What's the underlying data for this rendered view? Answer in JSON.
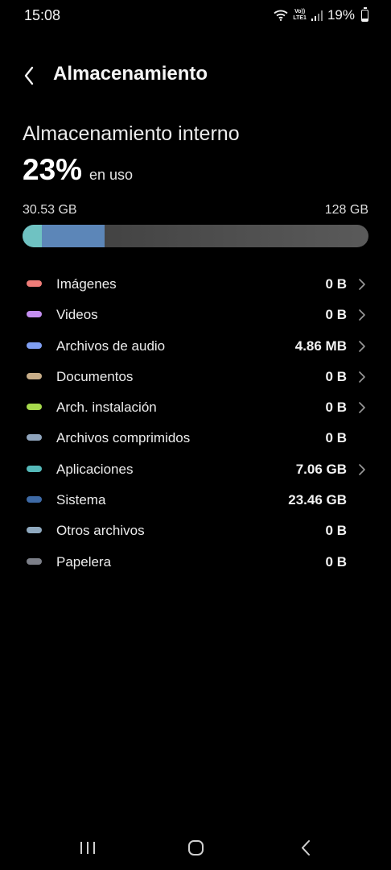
{
  "status_bar": {
    "time": "15:08",
    "volte_top": "Vo))",
    "volte_bottom": "LTE1",
    "battery": "19%"
  },
  "header": {
    "title": "Almacenamiento"
  },
  "storage": {
    "title": "Almacenamiento interno",
    "percent": "23%",
    "percent_label": "en uso",
    "used": "30.53 GB",
    "total": "128 GB",
    "bar_segments": [
      {
        "name": "Aplicaciones",
        "fraction": 0.055,
        "color": "#6fc2c2"
      },
      {
        "name": "Sistema",
        "fraction": 0.183,
        "color": "#5c86b8"
      }
    ]
  },
  "categories": [
    {
      "label": "Imágenes",
      "value": "0 B",
      "color": "#ef7c78",
      "chevron": true
    },
    {
      "label": "Videos",
      "value": "0 B",
      "color": "#c48ef0",
      "chevron": true
    },
    {
      "label": "Archivos de audio",
      "value": "4.86 MB",
      "color": "#7f9ef2",
      "chevron": true
    },
    {
      "label": "Documentos",
      "value": "0 B",
      "color": "#c8ad88",
      "chevron": true
    },
    {
      "label": "Arch. instalación",
      "value": "0 B",
      "color": "#a6d94c",
      "chevron": true
    },
    {
      "label": "Archivos comprimidos",
      "value": "0 B",
      "color": "#8fa4bc",
      "chevron": false
    },
    {
      "label": "Aplicaciones",
      "value": "7.06 GB",
      "color": "#55b9b9",
      "chevron": true
    },
    {
      "label": "Sistema",
      "value": "23.46 GB",
      "color": "#3e6aa6",
      "chevron": false
    },
    {
      "label": "Otros archivos",
      "value": "0 B",
      "color": "#8fa9bf",
      "chevron": false
    },
    {
      "label": "Papelera",
      "value": "0 B",
      "color": "#7c7f88",
      "chevron": false
    }
  ],
  "icons": {
    "back": "back-arrow-icon",
    "chevron": "chevron-right-icon",
    "nav_recents": "recent-apps-icon",
    "nav_home": "home-icon",
    "nav_back": "nav-back-icon"
  }
}
